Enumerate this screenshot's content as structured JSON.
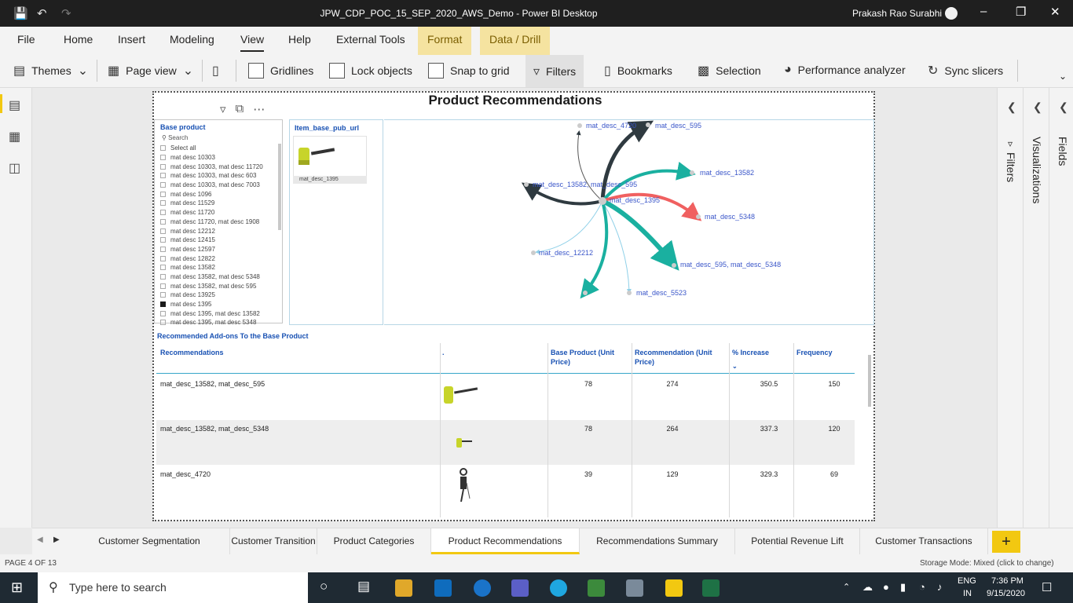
{
  "window": {
    "title": "JPW_CDP_POC_15_SEP_2020_AWS_Demo - Power BI Desktop",
    "user": "Prakash Rao Surabhi"
  },
  "ribbon_tabs": [
    "File",
    "Home",
    "Insert",
    "Modeling",
    "View",
    "Help",
    "External Tools",
    "Format",
    "Data / Drill"
  ],
  "ribbon": {
    "themes": "Themes",
    "page_view": "Page view",
    "gridlines": "Gridlines",
    "lock_objects": "Lock objects",
    "snap_to_grid": "Snap to grid",
    "filters": "Filters",
    "bookmarks": "Bookmarks",
    "selection": "Selection",
    "performance_analyzer": "Performance analyzer",
    "sync_slicers": "Sync slicers"
  },
  "report": {
    "title": "Product Recommendations"
  },
  "slicer": {
    "header": "Base product",
    "search_placeholder": "Search",
    "items": [
      {
        "label": "Select all",
        "checked": false
      },
      {
        "label": "mat desc 10303",
        "checked": false
      },
      {
        "label": "mat desc 10303, mat desc 11720",
        "checked": false
      },
      {
        "label": "mat desc 10303, mat desc 603",
        "checked": false
      },
      {
        "label": "mat desc 10303, mat desc 7003",
        "checked": false
      },
      {
        "label": "mat desc 1096",
        "checked": false
      },
      {
        "label": "mat desc 11529",
        "checked": false
      },
      {
        "label": "mat desc 11720",
        "checked": false
      },
      {
        "label": "mat desc 11720, mat desc 1908",
        "checked": false
      },
      {
        "label": "mat desc 12212",
        "checked": false
      },
      {
        "label": "mat desc 12415",
        "checked": false
      },
      {
        "label": "mat desc 12597",
        "checked": false
      },
      {
        "label": "mat desc 12822",
        "checked": false
      },
      {
        "label": "mat desc 13582",
        "checked": false
      },
      {
        "label": "mat desc 13582, mat desc 5348",
        "checked": false
      },
      {
        "label": "mat desc 13582, mat desc 595",
        "checked": false
      },
      {
        "label": "mat desc 13925",
        "checked": false
      },
      {
        "label": "mat desc 1395",
        "checked": true
      },
      {
        "label": "mat desc 1395, mat desc 13582",
        "checked": false
      },
      {
        "label": "mat desc 1395, mat desc 5348",
        "checked": false
      }
    ]
  },
  "item_card": {
    "header": "Item_base_pub_url",
    "caption": "mat_desc_1395"
  },
  "network": {
    "center": "mat_desc_1395",
    "nodes": [
      {
        "label": "mat_desc_4720"
      },
      {
        "label": "mat_desc_595"
      },
      {
        "label": "mat_desc_13582"
      },
      {
        "label": "mat_desc_13582, mat_desc_595"
      },
      {
        "label": "mat_desc_5348"
      },
      {
        "label": "mat_desc_12212"
      },
      {
        "label": "mat_desc_595, mat_desc_5348"
      },
      {
        "label": "mat_desc_5523"
      }
    ]
  },
  "table": {
    "title": "Recommended Add-ons To the Base Product",
    "headers": {
      "recommendations": "Recommendations",
      "image": ".",
      "base_price": "Base Product (Unit Price)",
      "rec_price": "Recommendation (Unit Price)",
      "pct_increase": "% Increase",
      "frequency": "Frequency"
    },
    "rows": [
      {
        "name": "mat_desc_13582, mat_desc_595",
        "base": "78",
        "rec": "274",
        "pct": "350.5",
        "freq": "150"
      },
      {
        "name": "mat_desc_13582, mat_desc_5348",
        "base": "78",
        "rec": "264",
        "pct": "337.3",
        "freq": "120"
      },
      {
        "name": "mat_desc_4720",
        "base": "39",
        "rec": "129",
        "pct": "329.3",
        "freq": "69"
      }
    ]
  },
  "panes": {
    "filters": "Filters",
    "visualizations": "Visualizations",
    "fields": "Fields"
  },
  "page_tabs": [
    "Customer Segmentation",
    "Customer Transition",
    "Product Categories",
    "Product Recommendations",
    "Recommendations Summary",
    "Potential Revenue Lift",
    "Customer Transactions"
  ],
  "active_page_tab": "Product Recommendations",
  "status": {
    "page": "PAGE 4 OF 13",
    "storage_mode": "Storage Mode: Mixed (click to change)"
  },
  "taskbar": {
    "search_placeholder": "Type here to search",
    "language_1": "ENG",
    "language_2": "IN",
    "time": "7:36 PM",
    "date": "9/15/2020"
  },
  "colors": {
    "accent_yellow": "#f2c811",
    "teal_edge": "#1ab0a0",
    "dark_edge": "#2f3a40",
    "red_edge": "#f06060",
    "light_edge": "#8fd0e8",
    "header_blue": "#1851b3"
  }
}
